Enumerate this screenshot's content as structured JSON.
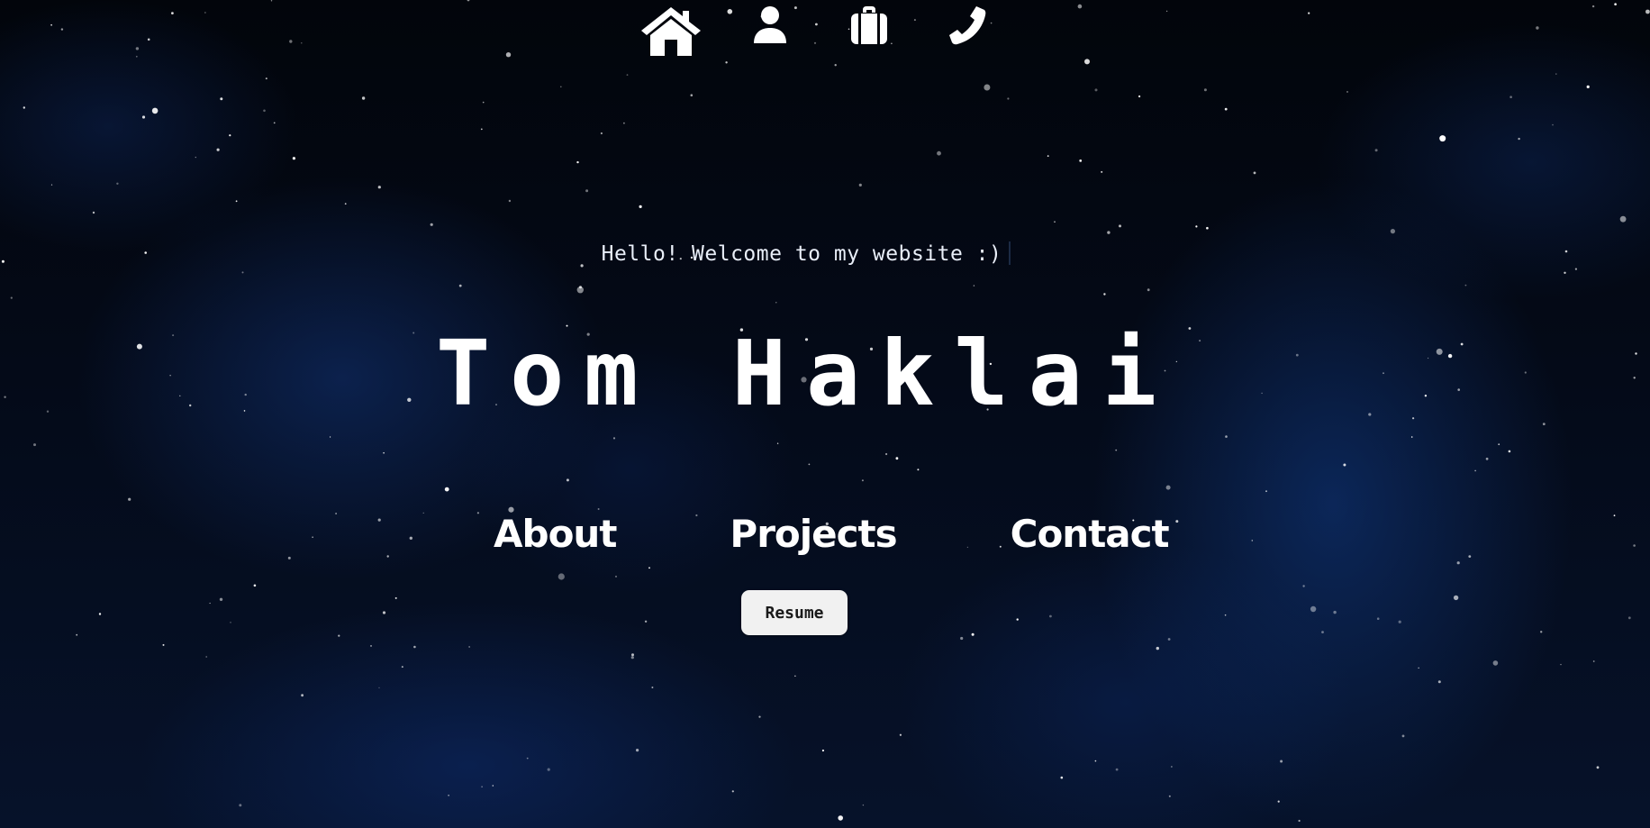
{
  "nav": {
    "icons": [
      {
        "name": "home-icon"
      },
      {
        "name": "user-icon"
      },
      {
        "name": "briefcase-icon"
      },
      {
        "name": "phone-icon"
      }
    ]
  },
  "hero": {
    "greeting": "Hello! Welcome to my website :)",
    "name": "Tom Haklai"
  },
  "sections": {
    "about": "About",
    "projects": "Projects",
    "contact": "Contact"
  },
  "resume": {
    "label": "Resume"
  },
  "colors": {
    "background": "#03060c",
    "nebula": "#12347a",
    "text": "#ffffff",
    "button": "#f1f1f1"
  }
}
